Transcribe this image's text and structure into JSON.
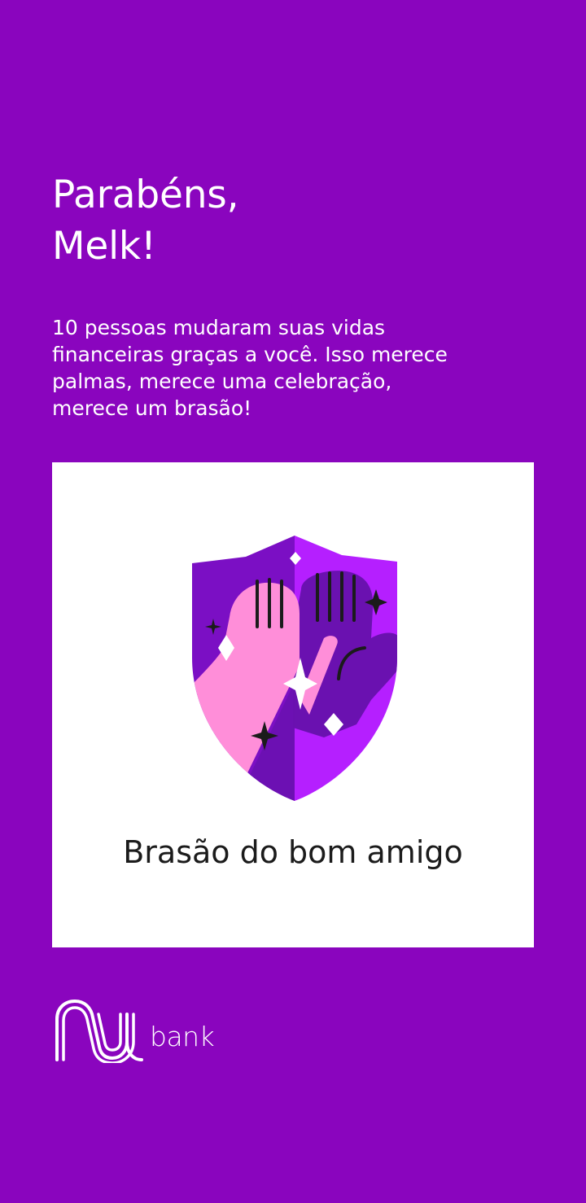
{
  "colors": {
    "background": "#8a05be",
    "card": "#ffffff",
    "text_light": "#ffffff",
    "text_dark": "#1b1b1b",
    "shield_dark": "#7b0fc4",
    "shield_light": "#b51fff",
    "hand_pink": "#ff8ed9",
    "hand_purple": "#6a11b0"
  },
  "greeting": {
    "line1": "Parabéns,",
    "line2": "Melk!"
  },
  "message": {
    "line1": "10 pessoas mudaram suas vidas",
    "line2": "financeiras graças a você. Isso merece",
    "line3": "palmas, merece uma celebração,",
    "line4": "merece um brasão!"
  },
  "badge": {
    "icon": "shield-high-five-icon",
    "title": "Brasão do bom amigo"
  },
  "footer": {
    "logo_icon": "nu-logo-icon",
    "brand_text": "bank"
  }
}
